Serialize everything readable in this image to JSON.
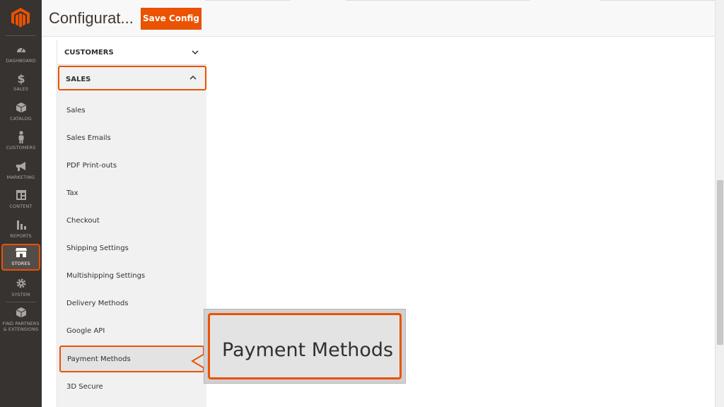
{
  "nav": {
    "items": [
      {
        "label": "DASHBOARD",
        "icon": "dashboard-icon"
      },
      {
        "label": "SALES",
        "icon": "dollar-icon"
      },
      {
        "label": "CATALOG",
        "icon": "cube-icon"
      },
      {
        "label": "CUSTOMERS",
        "icon": "person-icon"
      },
      {
        "label": "MARKETING",
        "icon": "megaphone-icon"
      },
      {
        "label": "CONTENT",
        "icon": "layout-icon"
      },
      {
        "label": "REPORTS",
        "icon": "bar-chart-icon"
      },
      {
        "label": "STORES",
        "icon": "store-icon"
      },
      {
        "label": "SYSTEM",
        "icon": "gear-icon"
      },
      {
        "label": "FIND PARTNERS",
        "label2": "& EXTENSIONS",
        "icon": "box-icon"
      }
    ]
  },
  "header": {
    "title": "Configurat...",
    "save_label": "Save Config"
  },
  "config": {
    "sections": [
      {
        "label": "CUSTOMERS",
        "state": "collapsed"
      },
      {
        "label": "SALES",
        "state": "expanded"
      }
    ],
    "sales_items": [
      "Sales",
      "Sales Emails",
      "PDF Print-outs",
      "Tax",
      "Checkout",
      "Shipping Settings",
      "Multishipping Settings",
      "Delivery Methods",
      "Google API",
      "Payment Methods",
      "3D Secure"
    ]
  },
  "callout": {
    "text": "Payment Methods"
  },
  "colors": {
    "accent": "#eb5202",
    "nav_bg": "#373330",
    "panel_bg": "#f1f1f1"
  }
}
